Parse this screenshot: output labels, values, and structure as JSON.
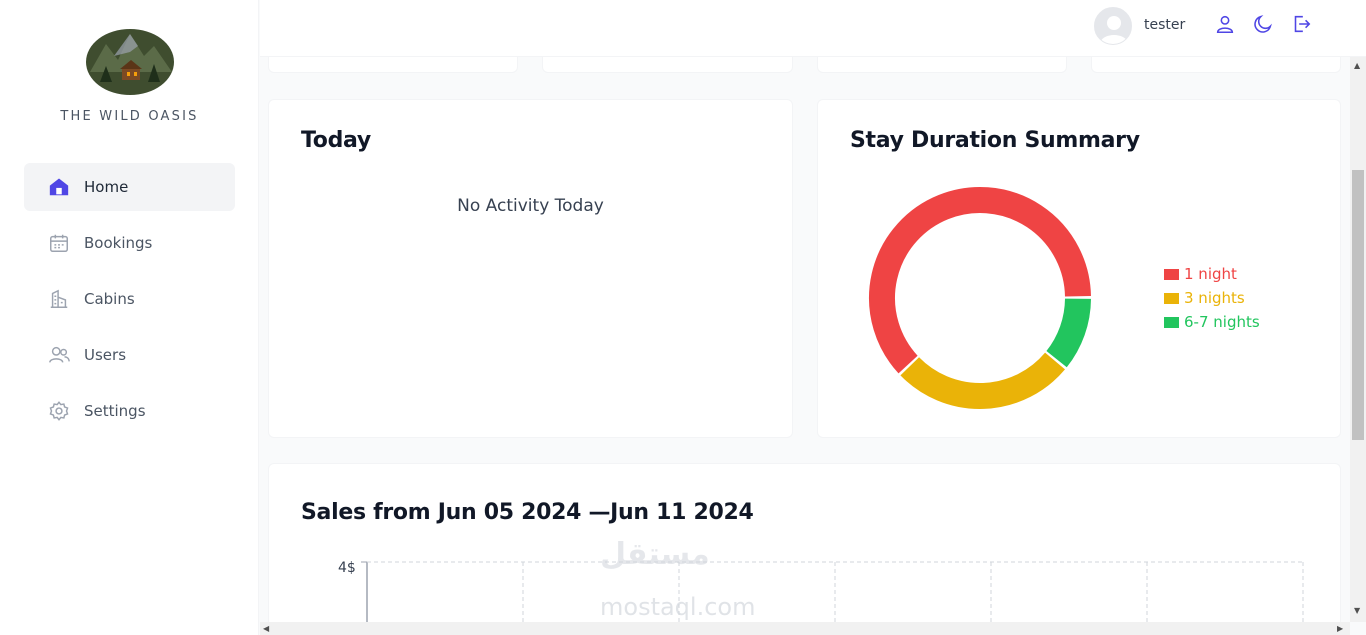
{
  "brand": {
    "name": "THE WILD OASIS",
    "logo_icon": "mountain-cabin-logo"
  },
  "sidebar": {
    "items": [
      {
        "label": "Home",
        "icon": "home-icon",
        "active": true
      },
      {
        "label": "Bookings",
        "icon": "calendar-icon",
        "active": false
      },
      {
        "label": "Cabins",
        "icon": "cabins-icon",
        "active": false
      },
      {
        "label": "Users",
        "icon": "users-icon",
        "active": false
      },
      {
        "label": "Settings",
        "icon": "gear-icon",
        "active": false
      }
    ]
  },
  "header": {
    "username": "tester",
    "actions": [
      "account-icon",
      "dark-mode-icon",
      "logout-icon"
    ]
  },
  "today": {
    "title": "Today",
    "empty_text": "No Activity Today"
  },
  "stay_duration": {
    "title": "Stay Duration Summary",
    "chart_data": {
      "type": "pie",
      "labels": [
        "1 night",
        "3 nights",
        "6-7 nights"
      ],
      "values": [
        62,
        27,
        11
      ],
      "colors": [
        "#ef4444",
        "#eab308",
        "#22c55e"
      ],
      "legend": "right"
    }
  },
  "sales": {
    "title": "Sales from Jun 05 2024 —Jun 11 2024",
    "y_tick": "4$"
  },
  "watermark": {
    "text": "مستقل",
    "sub": "mostaql.com"
  },
  "colors": {
    "accent": "#4f46e5",
    "text": "#374151"
  }
}
